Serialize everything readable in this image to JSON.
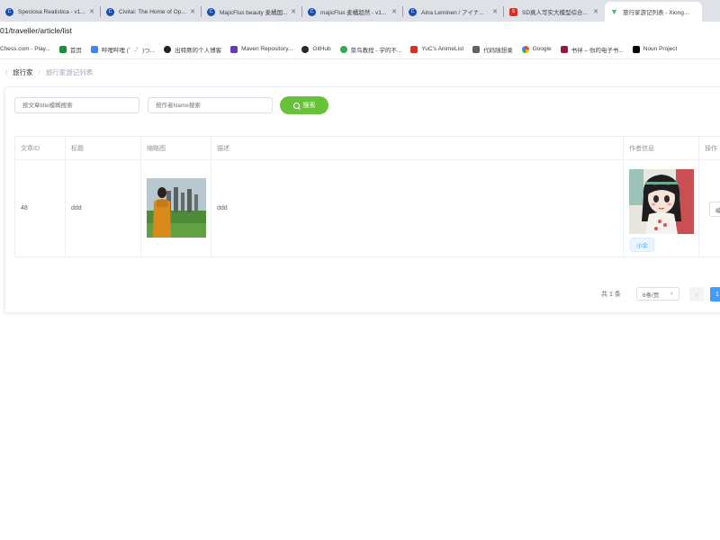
{
  "browser": {
    "tabs": [
      {
        "title": "Speciosa Realistica - v1...",
        "icon": "civitai-icon",
        "active": false
      },
      {
        "title": "Civitai: The Home of Op...",
        "icon": "civitai-icon",
        "active": false
      },
      {
        "title": "MajicFlus beauty 麦橘国...",
        "icon": "civitai-icon",
        "active": false
      },
      {
        "title": "majicFlus 麦橘超然 - v1...",
        "icon": "civitai-icon",
        "active": false
      },
      {
        "title": "Aina Leminen / アイナ...",
        "icon": "civitai-icon",
        "active": false
      },
      {
        "title": "SD真人写实大模型综合...",
        "icon": "sd-icon",
        "active": false
      },
      {
        "title": "旅行家游记列表 - Xiong...",
        "icon": "vue-icon",
        "active": true
      }
    ],
    "url": "01/traveller/article/list",
    "bookmarks": [
      {
        "label": "Chess.com - Play...",
        "icon": "none"
      },
      {
        "label": "首页",
        "icon": "green"
      },
      {
        "label": "哔哩哔哩 (゜-゜)つ...",
        "icon": "blue"
      },
      {
        "label": "出特厥的个人博客",
        "icon": "dark"
      },
      {
        "label": "Maven Repository...",
        "icon": "purple"
      },
      {
        "label": "GitHub",
        "icon": "ghub"
      },
      {
        "label": "菜鸟教程 - 学的不...",
        "icon": "lgreen"
      },
      {
        "label": "YuC's AnimeList",
        "icon": "red"
      },
      {
        "label": "代码随想录",
        "icon": "mono"
      },
      {
        "label": "Google",
        "icon": "g"
      },
      {
        "label": "书伴 – 你的电子书...",
        "icon": "maroon"
      },
      {
        "label": "Noun Project",
        "icon": "black"
      }
    ]
  },
  "breadcrumb": {
    "parent": "旅行家",
    "current": "旅行家游记列表"
  },
  "search": {
    "title_placeholder": "按文章title模糊搜索",
    "name_placeholder": "按作者Name搜索",
    "button_label": "搜索"
  },
  "table": {
    "headers": {
      "id": "文章ID",
      "title": "标题",
      "thumb": "缩略图",
      "desc": "描述",
      "author": "作者信息",
      "action": "操作"
    },
    "rows": [
      {
        "id": "48",
        "title": "ddd",
        "desc": "ddd",
        "author_tag": "小伞",
        "action": "编辑"
      }
    ]
  },
  "pagination": {
    "total": "共 1 条",
    "page_size": "6条/页",
    "prev": "‹",
    "current_page": "1"
  }
}
